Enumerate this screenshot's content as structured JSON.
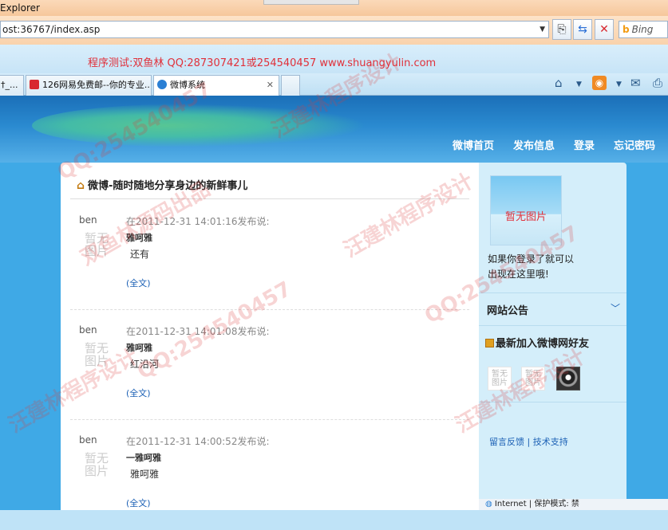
{
  "browser": {
    "title": "Explorer",
    "address": "ost:36767/index.asp",
    "search_placeholder": "Bing",
    "tabs": [
      {
        "label": "†_..."
      },
      {
        "label": "126网易免费邮--你的专业..."
      },
      {
        "label": "微博系统"
      }
    ],
    "status_text": "Internet | 保护模式: 禁"
  },
  "promo": "程序测试:双鱼林 QQ:287307421或254540457 www.shuangyulin.com",
  "nav": {
    "items": [
      "微博首页",
      "发布信息",
      "登录",
      "忘记密码"
    ]
  },
  "main": {
    "heading": "微博-随时随地分享身边的新鲜事儿",
    "posts": [
      {
        "user": "ben",
        "avatar": "暂无图片",
        "time": "在2011-12-31 14:01:16发布说:",
        "title": "雅呵雅",
        "body": "还有",
        "more": "(全文)"
      },
      {
        "user": "ben",
        "avatar": "暂无图片",
        "time": "在2011-12-31 14:01:08发布说:",
        "title": "雅呵雅",
        "body": "红沿河",
        "more": "(全文)"
      },
      {
        "user": "ben",
        "avatar": "暂无图片",
        "time": "在2011-12-31 14:00:52发布说:",
        "title": "一雅呵雅",
        "body": "雅呵雅",
        "more": "(全文)"
      }
    ]
  },
  "sidebar": {
    "no_image": "暂无图片",
    "login_hint_1": "如果你登录了就可以",
    "login_hint_2": "出现在这里哦!",
    "notice_label": "网站公告",
    "friends_label": "最新加入微博网好友",
    "friend_placeholder": "暂无图片",
    "link_feedback": "留言反馈",
    "link_support": "技术支持",
    "link_sep": "|"
  },
  "watermarks": [
    "汪建林程序设计",
    "QQ:254540457",
    "双鱼林源码出品"
  ],
  "colors": {
    "accent": "#1a5fb4",
    "promo_red": "#e0303a",
    "banner_blue": "#2a8ad0"
  }
}
